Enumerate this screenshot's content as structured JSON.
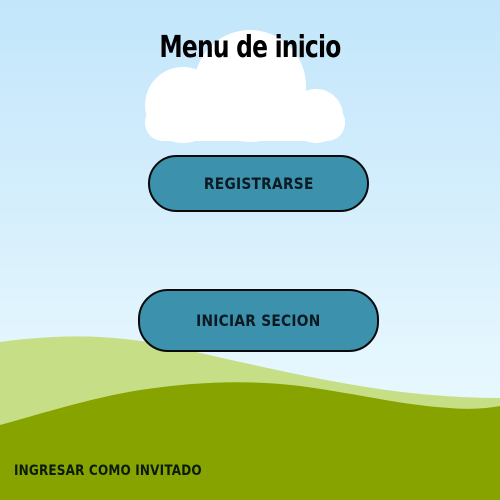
{
  "screen": {
    "title": "Menu de inicio",
    "register_button": "REGISTRARSE",
    "login_button": "INICIAR SECION",
    "guest_link": "INGRESAR COMO INVITADO"
  },
  "colors": {
    "sky_top": "#c3e6fb",
    "button_fill": "#3c91ac",
    "hill_light": "#c6df87",
    "hill_dark": "#86a300",
    "cloud": "#ffffff"
  }
}
